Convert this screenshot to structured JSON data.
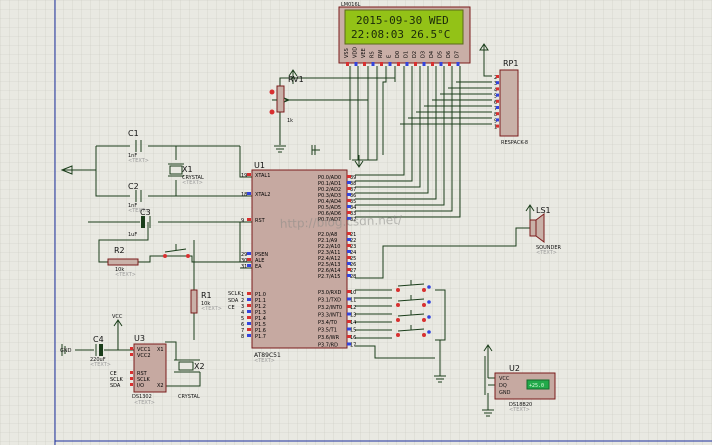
{
  "lcd": {
    "title": "LM016L",
    "line1": "2015-09-30 WED",
    "line2": "22:08:03  26.5°C",
    "pins": [
      "VSS",
      "VDD",
      "VEE",
      "RS",
      "RW",
      "E",
      "D0",
      "D1",
      "D2",
      "D3",
      "D4",
      "D5",
      "D6",
      "D7"
    ]
  },
  "watermark": "http://blog.csdn.net/",
  "components": {
    "rv1": {
      "ref": "RV1",
      "value": "1k"
    },
    "rp1": {
      "ref": "RP1",
      "value": "RESPACK-8",
      "pins": [
        "2",
        "3",
        "4",
        "5",
        "6",
        "7",
        "8",
        "9",
        "1"
      ]
    },
    "c1": {
      "ref": "C1",
      "value": "1nF",
      "text": "<TEXT>"
    },
    "c2": {
      "ref": "C2",
      "value": "1nF",
      "text": "<TEXT>"
    },
    "c3": {
      "ref": "C3",
      "value": "1uF"
    },
    "x1": {
      "ref": "X1",
      "value": "CRYSTAL",
      "text": "<TEXT>"
    },
    "r2": {
      "ref": "R2",
      "value": "10k",
      "text": "<TEXT>"
    },
    "r1": {
      "ref": "R1",
      "value": "10k",
      "text": "<TEXT>"
    },
    "u1": {
      "ref": "U1",
      "part": "AT89C51",
      "text": "<TEXT>",
      "left_pins": [
        {
          "num": "19",
          "name": "XTAL1"
        },
        {
          "num": "18",
          "name": "XTAL2"
        },
        {
          "num": "9",
          "name": "RST"
        },
        {
          "num": "29",
          "name": "PSEN"
        },
        {
          "num": "30",
          "name": "ALE"
        },
        {
          "num": "31",
          "name": "EA"
        },
        {
          "num": "1",
          "name": "P1.0"
        },
        {
          "num": "2",
          "name": "P1.1"
        },
        {
          "num": "3",
          "name": "P1.2"
        },
        {
          "num": "4",
          "name": "P1.3"
        },
        {
          "num": "5",
          "name": "P1.4"
        },
        {
          "num": "6",
          "name": "P1.5"
        },
        {
          "num": "7",
          "name": "P1.6"
        },
        {
          "num": "8",
          "name": "P1.7"
        }
      ],
      "right_pins_p0": [
        {
          "num": "39",
          "name": "P0.0/AD0"
        },
        {
          "num": "38",
          "name": "P0.1/AD1"
        },
        {
          "num": "37",
          "name": "P0.2/AD2"
        },
        {
          "num": "36",
          "name": "P0.3/AD3"
        },
        {
          "num": "35",
          "name": "P0.4/AD4"
        },
        {
          "num": "34",
          "name": "P0.5/AD5"
        },
        {
          "num": "33",
          "name": "P0.6/AD6"
        },
        {
          "num": "32",
          "name": "P0.7/AD7"
        }
      ],
      "right_pins_p2": [
        {
          "num": "21",
          "name": "P2.0/A8"
        },
        {
          "num": "22",
          "name": "P2.1/A9"
        },
        {
          "num": "23",
          "name": "P2.2/A10"
        },
        {
          "num": "24",
          "name": "P2.3/A11"
        },
        {
          "num": "25",
          "name": "P2.4/A12"
        },
        {
          "num": "26",
          "name": "P2.5/A13"
        },
        {
          "num": "27",
          "name": "P2.6/A14"
        },
        {
          "num": "28",
          "name": "P2.7/A15"
        }
      ],
      "right_pins_p3": [
        {
          "num": "10",
          "name": "P3.0/RXD"
        },
        {
          "num": "11",
          "name": "P3.1/TXD"
        },
        {
          "num": "12",
          "name": "P3.2/INT0"
        },
        {
          "num": "13",
          "name": "P3.3/INT1"
        },
        {
          "num": "14",
          "name": "P3.4/T0"
        },
        {
          "num": "15",
          "name": "P3.5/T1"
        },
        {
          "num": "16",
          "name": "P3.6/WR"
        },
        {
          "num": "17",
          "name": "P3.7/RD"
        }
      ],
      "net_labels": [
        "SCLK",
        "SDA",
        "CE"
      ]
    },
    "ls1": {
      "ref": "LS1",
      "value": "SOUNDER",
      "text": "<TEXT>"
    },
    "c4": {
      "ref": "C4",
      "value": "220uF",
      "text": "<TEXT>"
    },
    "u3": {
      "ref": "U3",
      "part": "DS1302",
      "text": "<TEXT>",
      "pins": [
        "VCC1",
        "VCC2",
        "X1",
        "X2",
        "RST",
        "SCLK",
        "I/O"
      ],
      "nets": [
        "CE",
        "SCLK",
        "SDA"
      ]
    },
    "x2": {
      "ref": "X2",
      "value": "CRYSTAL"
    },
    "u2": {
      "ref": "U2",
      "part": "DS18B20",
      "text": "<TEXT>",
      "pins": [
        "VCC",
        "DQ",
        "GND"
      ],
      "readout": "+25.0"
    },
    "vcc": "VCC",
    "gnd": "GND"
  }
}
